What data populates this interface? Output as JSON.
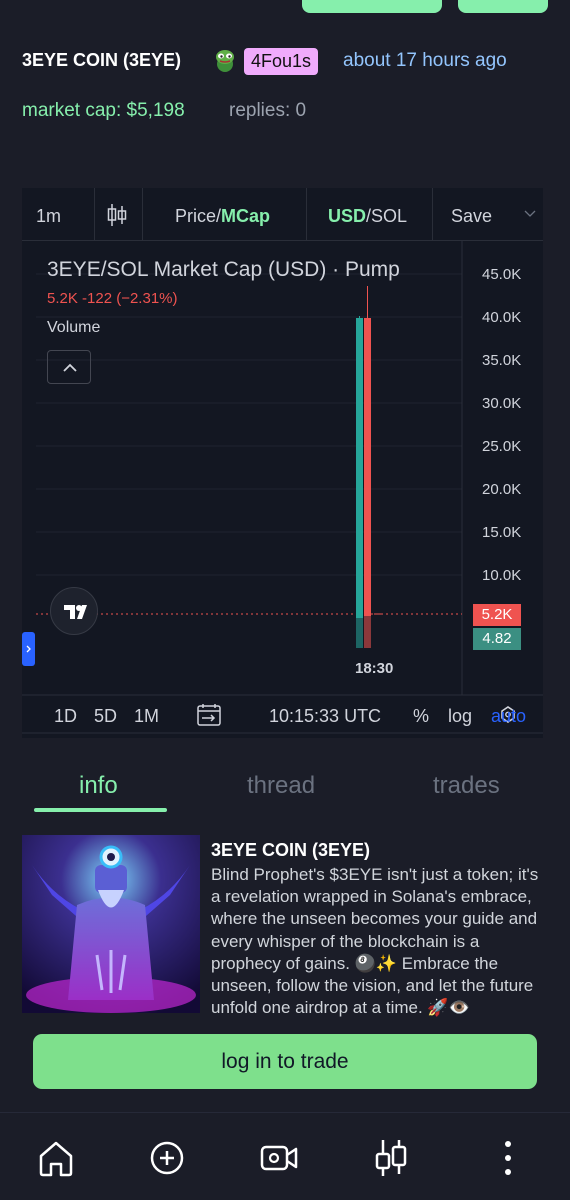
{
  "header": {
    "coin_name": "3EYE COIN (3EYE)",
    "user_badge": "4Fou1s",
    "time_ago": "about 17 hours ago",
    "market_cap": "market cap: $5,198",
    "replies": "replies: 0"
  },
  "chart": {
    "toolbar": {
      "interval": "1m",
      "price_label": "Price/",
      "mcap_label": "MCap",
      "usd_label": "USD",
      "sol_label": "/SOL",
      "save_label": "Save"
    },
    "title": "3EYE/SOL Market Cap (USD) · Pump",
    "ohlc": "5.2K  -122 (−2.31%)",
    "volume_label": "Volume",
    "y_ticks": [
      "45.0K",
      "40.0K",
      "35.0K",
      "30.0K",
      "25.0K",
      "20.0K",
      "15.0K",
      "10.0K"
    ],
    "price_tag": "5.2K",
    "volume_tag": "4.82",
    "time_tick": "18:30",
    "ranges": [
      "1D",
      "5D",
      "1M"
    ],
    "clock": "10:15:33 UTC",
    "percent_label": "%",
    "log_label": "log",
    "auto_label": "auto",
    "colors": {
      "up": "#26a69a",
      "down": "#ef5350",
      "accent": "#2962ff"
    }
  },
  "chart_data": {
    "type": "candlestick",
    "title": "3EYE/SOL Market Cap (USD) · Pump",
    "y_ticks": [
      10000,
      15000,
      20000,
      25000,
      30000,
      35000,
      40000,
      45000
    ],
    "candles": [
      {
        "color": "up",
        "open": 5000,
        "close": 40500,
        "high": 40500,
        "low": 5000
      },
      {
        "color": "down",
        "open": 40500,
        "close": 5200,
        "high": 42000,
        "low": 5200
      }
    ],
    "last_value": "5.2K",
    "volume_last": "4.82",
    "x_label": "18:30"
  },
  "tabs": [
    "info",
    "thread",
    "trades"
  ],
  "info": {
    "title": "3EYE COIN (3EYE)",
    "description": "Blind Prophet's $3EYE isn't just a token; it's a revelation wrapped in Solana's embrace, where the unseen becomes your guide and every whisper of the blockchain is a prophecy of gains. 🎱✨ Embrace the unseen, follow the vision, and let the future unfold one airdrop at a time. 🚀👁️"
  },
  "login_label": "log in to trade",
  "nav": [
    "home-icon",
    "create-icon",
    "video-icon",
    "chart-icon",
    "more-icon"
  ]
}
